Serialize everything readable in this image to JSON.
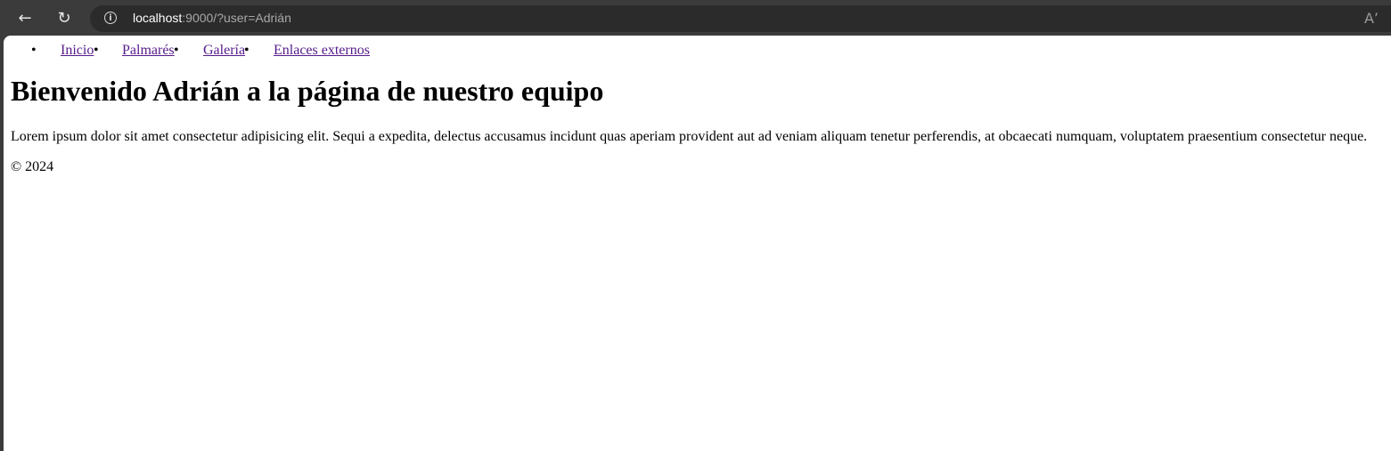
{
  "browser": {
    "url_host": "localhost",
    "url_rest": ":9000/?user=Adrián",
    "icons": {
      "back": "back-arrow-icon",
      "reload": "reload-icon",
      "info": "info-icon",
      "read_aloud": "read-aloud-icon"
    }
  },
  "nav": {
    "items": [
      {
        "label": "Inicio"
      },
      {
        "label": "Palmarés"
      },
      {
        "label": "Galería"
      },
      {
        "label": "Enlaces externos"
      }
    ]
  },
  "main": {
    "heading": "Bienvenido Adrián a la página de nuestro equipo",
    "paragraph": "Lorem ipsum dolor sit amet consectetur adipisicing elit. Sequi a expedita, delectus accusamus incidunt quas aperiam provident aut ad veniam aliquam tenetur perferendis, at obcaecati numquam, voluptatem praesentium consectetur neque."
  },
  "footer": {
    "text": "© 2024"
  },
  "colors": {
    "chrome": "#3b3b3b",
    "omnibox": "#2b2b2b",
    "link_visited": "#551a8b"
  }
}
